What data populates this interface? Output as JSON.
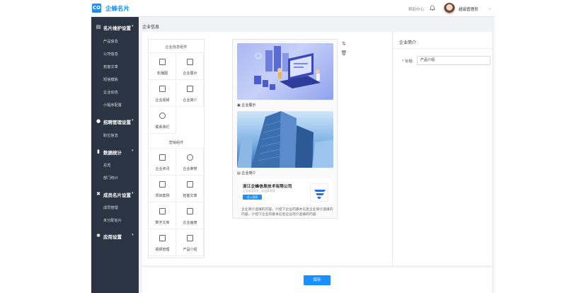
{
  "header": {
    "logo_glyph": "CO",
    "app_name": "企蜂名片",
    "help_label": "帮助中心",
    "user_name": "超级管理员",
    "bell_icon": "bell-icon",
    "caret_icon": "chevron-down-icon"
  },
  "sidebar": {
    "groups": [
      {
        "label": "名片维护设置",
        "icon": "card-icon",
        "items": [
          "产品信息",
          "公司信息",
          "拓客文章",
          "短信模板",
          "企业动态",
          "小程序配置"
        ]
      },
      {
        "label": "招聘管理设置",
        "icon": "users-icon",
        "items": [
          "职位信息"
        ]
      },
      {
        "label": "数据统计",
        "icon": "bar-chart-icon",
        "items": [
          "总览",
          "部门统计"
        ]
      },
      {
        "label": "成员名片设置",
        "icon": "tools-icon",
        "items": [
          "成员管理",
          "未分配名片"
        ]
      },
      {
        "label": "应用设置",
        "icon": "gear-icon",
        "items": []
      }
    ]
  },
  "breadcrumb": "企业信息",
  "components": {
    "section1_title": "企业信息组件",
    "section1_items": [
      "轮播图",
      "企业展示",
      "企业视频",
      "企业简介",
      "联系我们"
    ],
    "section2_title": "营销组件",
    "section2_items": [
      "企业资讯",
      "企业荣誉",
      "项目案例",
      "拓客文章",
      "数字文库",
      "企业画册",
      "视频管理",
      "产品介绍"
    ]
  },
  "preview": {
    "module_show_label": "企业展示",
    "module_intro_label": "企业简介",
    "company_name": "浙江企蜂信息技术有限公司",
    "company_sub": "企业电话信息，欢迎联系我",
    "enter_button": "进入官网",
    "intro_text": "企业简介选填的内容。介绍下企业的基本信息企业简介选填的内容。介绍下企业的基本信息企业简介选填的内容"
  },
  "right_panel": {
    "title": "企业简介",
    "label": "标题:",
    "required_mark": "*",
    "input_value": "产品介绍"
  },
  "footer": {
    "save_label": "保存"
  },
  "colors": {
    "accent": "#1890ff",
    "sidebar_bg": "#2b3443"
  }
}
